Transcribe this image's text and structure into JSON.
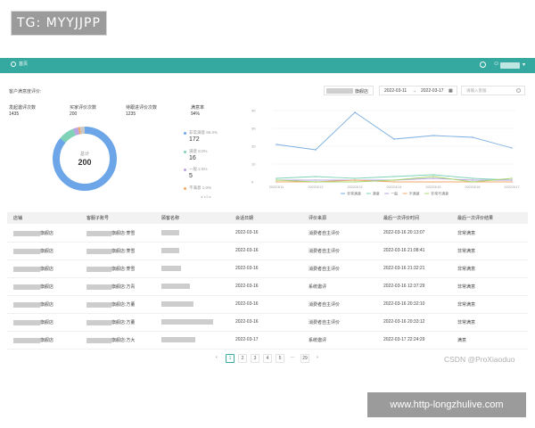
{
  "watermarks": {
    "top": "TG: MYYJJPP",
    "csdn": "CSDN @ProXiaoduo",
    "bottom": "www.http-longzhulive.com"
  },
  "header": {
    "menu_label": "首页"
  },
  "section_title": "客户满意度评价:",
  "stats": [
    {
      "label": "发起邀评次数",
      "value": "1435"
    },
    {
      "label": "买家评价次数",
      "value": "200"
    },
    {
      "label": "待跟进评价次数",
      "value": "1235"
    },
    {
      "label": "满意率",
      "value": "94%"
    }
  ],
  "filters": {
    "store_suffix": "旗舰店",
    "date_start": "2022-03-11",
    "date_sep": "→",
    "date_end": "2022-03-17",
    "search_placeholder": "请输入客服"
  },
  "donut": {
    "center_label": "总计",
    "center_value": "200",
    "segments": [
      {
        "name": "非常满意",
        "value": 172,
        "color": "#6ca6e8"
      },
      {
        "name": "满意",
        "value": 16,
        "color": "#7fd1b8"
      },
      {
        "name": "一般",
        "value": 5,
        "color": "#b9a3e0"
      },
      {
        "name": "不满意",
        "value": 2,
        "color": "#f0a868"
      },
      {
        "name": "非常不满意",
        "value": 5,
        "color": "#c8c8c8"
      }
    ]
  },
  "legend_items": [
    {
      "label": "非常满意 86.0%",
      "value": "172",
      "color": "#6ca6e8"
    },
    {
      "label": "满意 8.0%",
      "value": "16",
      "color": "#7fd1b8"
    },
    {
      "label": "一般 2.5%",
      "value": "5",
      "color": "#b9a3e0"
    },
    {
      "label": "不满意 1.0%",
      "value": "",
      "color": "#f0a868"
    }
  ],
  "legend_more": "◂ 1/2 ▸",
  "chart_data": {
    "type": "line",
    "x": [
      "2022/3/11",
      "2022/3/12",
      "2022/3/13",
      "2022/3/14",
      "2022/3/15",
      "2022/3/16",
      "2022/3/17"
    ],
    "ylim": [
      0,
      40
    ],
    "yticks": [
      "0",
      "10",
      "20",
      "30",
      "40"
    ],
    "series": [
      {
        "name": "非常满意",
        "color": "#7aaee0",
        "values": [
          21,
          18,
          39,
          24,
          26,
          25,
          19
        ]
      },
      {
        "name": "满意",
        "color": "#7fd1b8",
        "values": [
          2,
          3,
          2,
          3,
          4,
          2,
          1
        ]
      },
      {
        "name": "一般",
        "color": "#b9a3e0",
        "values": [
          1,
          1,
          1,
          1,
          2,
          1,
          1
        ]
      },
      {
        "name": "不满意",
        "color": "#f0a868",
        "values": [
          0,
          0,
          1,
          0,
          0,
          0,
          0
        ]
      },
      {
        "name": "非常不满意",
        "color": "#a8d86e",
        "values": [
          1,
          0,
          0,
          1,
          3,
          0,
          2
        ]
      }
    ]
  },
  "table": {
    "headers": [
      "店铺",
      "客服子账号",
      "顾客名称",
      "会话日期",
      "评价来源",
      "最后一次评价时间",
      "最后一次评价结果"
    ],
    "rows": [
      {
        "store": "旗舰店",
        "agent": "旗舰店:菱雪",
        "date": "2022-03-16",
        "source": "消费者自主评价",
        "time": "2022-03-16 20:13:07",
        "result": "非常满意"
      },
      {
        "store": "旗舰店",
        "agent": "旗舰店:菱雪",
        "date": "2022-03-16",
        "source": "消费者自主评价",
        "time": "2022-03-16 21:08:41",
        "result": "非常满意"
      },
      {
        "store": "旗舰店",
        "agent": "旗舰店:菱雪",
        "date": "2022-03-16",
        "source": "消费者自主评价",
        "time": "2022-03-16 21:32:21",
        "result": "非常满意"
      },
      {
        "store": "旗舰店",
        "agent": "旗舰店:方青",
        "date": "2022-03-16",
        "source": "系统邀评",
        "time": "2022-03-16 12:37:29",
        "result": "非常满意"
      },
      {
        "store": "旗舰店",
        "agent": "旗舰店:方董",
        "date": "2022-03-16",
        "source": "消费者自主评价",
        "time": "2022-03-16 20:32:10",
        "result": "非常满意"
      },
      {
        "store": "旗舰店",
        "agent": "旗舰店:方董",
        "date": "2022-03-16",
        "source": "消费者自主评价",
        "time": "2022-03-16 20:33:12",
        "result": "非常满意"
      },
      {
        "store": "旗舰店",
        "agent": "旗舰店:方大",
        "date": "2022-03-17",
        "source": "系统邀评",
        "time": "2022-03-17 22:24:29",
        "result": "满意"
      }
    ]
  },
  "pagination": {
    "prev": "‹",
    "pages": [
      "1",
      "2",
      "3",
      "4",
      "5",
      "···",
      "29"
    ],
    "next": "›"
  }
}
